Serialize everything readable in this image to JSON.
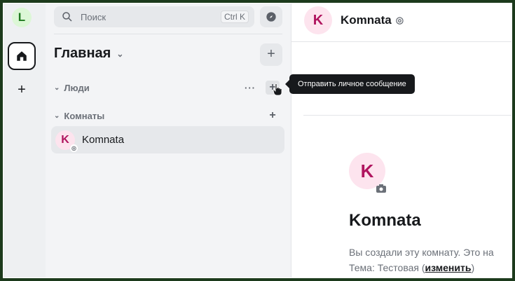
{
  "spacebar": {
    "user_initial": "L",
    "add_space_icon": "plus-icon"
  },
  "roomlist": {
    "search_placeholder": "Поиск",
    "search_shortcut": "Ctrl K",
    "title": "Главная",
    "sections": [
      {
        "label": "Люди"
      },
      {
        "label": "Комнаты"
      }
    ],
    "rooms": [
      {
        "initial": "K",
        "name": "Komnata"
      }
    ]
  },
  "header": {
    "initial": "K",
    "title": "Komnata"
  },
  "intro": {
    "initial": "K",
    "title": "Komnata",
    "text": "Вы создали эту комнату. Это на",
    "topic_prefix": "Тема: Тестовая (",
    "topic_link": "изменить",
    "topic_suffix": ")"
  },
  "tooltip": {
    "text": "Отправить личное сообщение"
  },
  "colors": {
    "accent_pink": "#b0155f",
    "user_green": "#1f7a1f",
    "frame_border": "#1c3a1c"
  }
}
